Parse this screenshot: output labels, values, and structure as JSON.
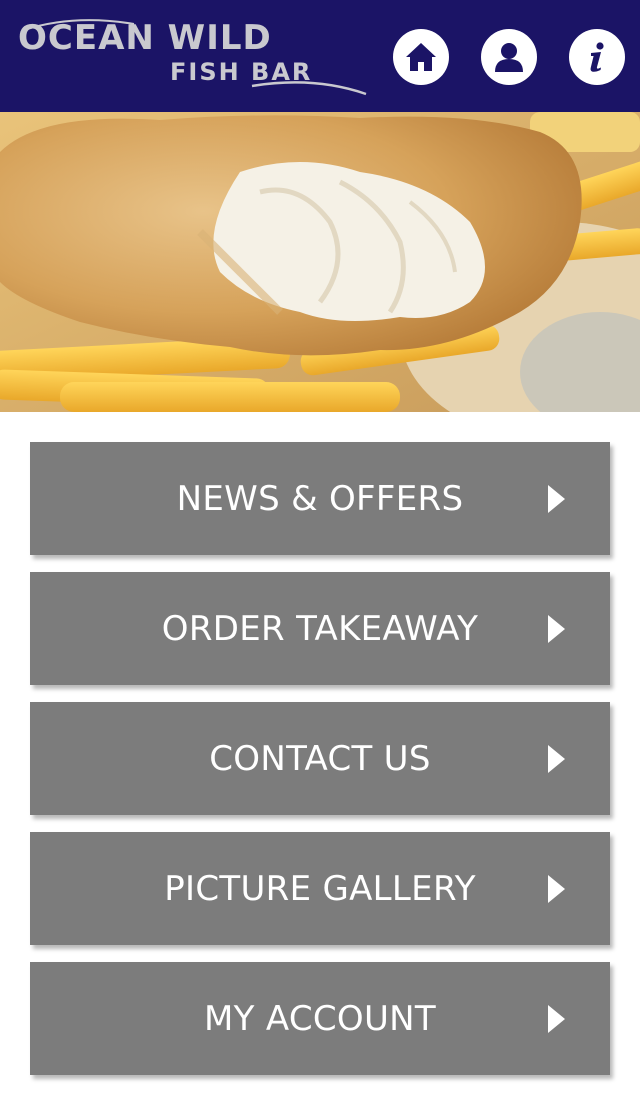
{
  "header": {
    "logo_line1": "OCEAN WILD",
    "logo_line2": "FISH BAR",
    "home_icon": "home-icon",
    "account_icon": "user-icon",
    "info_icon": "info-icon",
    "background_color": "#1b1466"
  },
  "hero": {
    "image": "fish-and-chips-photo"
  },
  "menu": {
    "button_color": "#7c7c7c",
    "arrow_icon": "chevron-right-icon",
    "items": [
      {
        "label": "NEWS & OFFERS"
      },
      {
        "label": "ORDER TAKEAWAY"
      },
      {
        "label": "CONTACT US"
      },
      {
        "label": "PICTURE GALLERY"
      },
      {
        "label": "MY ACCOUNT"
      }
    ]
  }
}
